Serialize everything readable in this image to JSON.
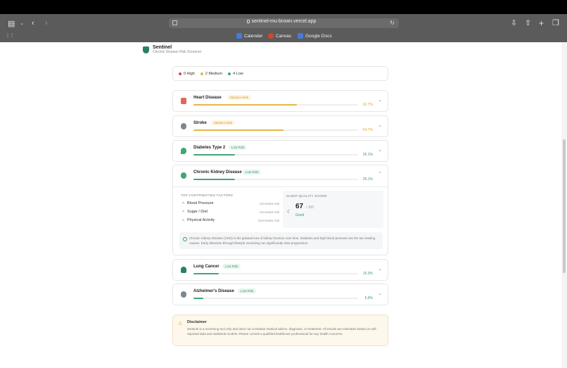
{
  "browser": {
    "url": "sentinel-mu-brown.vercel.app",
    "bookmarks": [
      {
        "label": "Calender",
        "color": "#3f7fe0"
      },
      {
        "label": "Canvas",
        "color": "#d8452b"
      },
      {
        "label": "Google Docs",
        "color": "#4a7bd8"
      }
    ]
  },
  "app": {
    "name": "Sentinel",
    "subtitle": "Chronic Disease Risk Screener"
  },
  "summary": {
    "high": "0 High",
    "medium": "2 Medium",
    "low": "4 Low",
    "colors": {
      "high": "#d94a4a",
      "medium": "#e5b54a",
      "low": "#3fa774"
    }
  },
  "diseases": [
    {
      "name": "Heart Disease",
      "badge": "Medium Risk",
      "level": "med",
      "percent": "62.7%",
      "value": 62.7,
      "icon": "heart-icon",
      "icon_color": "#e0675c"
    },
    {
      "name": "Stroke",
      "badge": "Medium Risk",
      "level": "med",
      "percent": "54.7%",
      "value": 54.7,
      "icon": "brain-icon",
      "icon_color": "#7c8790"
    },
    {
      "name": "Diabetes Type 2",
      "badge": "Low Risk",
      "level": "low",
      "percent": "25.1%",
      "value": 25.1,
      "icon": "drop-icon",
      "icon_color": "#3fa774"
    },
    {
      "name": "Chronic Kidney Disease",
      "badge": "Low Risk",
      "level": "low",
      "percent": "25.1%",
      "value": 25.1,
      "icon": "kidney-icon",
      "icon_color": "#3fa774"
    },
    {
      "name": "Lung Cancer",
      "badge": "Low Risk",
      "level": "low",
      "percent": "15.3%",
      "value": 15.3,
      "icon": "lungs-icon",
      "icon_color": "#2c7f67"
    },
    {
      "name": "Alzheimer's Disease",
      "badge": "Low Risk",
      "level": "low",
      "percent": "5.9%",
      "value": 5.9,
      "icon": "brain-icon",
      "icon_color": "#7c8790"
    }
  ],
  "details": {
    "factors_title": "TOP CONTRIBUTING FACTORS",
    "factors": [
      {
        "name": "Blood Pressure",
        "effect": "Increases risk"
      },
      {
        "name": "Sugar / Diet",
        "effect": "Increases risk"
      },
      {
        "name": "Physical Activity",
        "effect": "Decreases risk"
      }
    ],
    "sleep_title": "SLEEP QUALITY SCORE",
    "sleep_score": "67",
    "sleep_max": "/ 100",
    "sleep_grade": "Good",
    "info": "Chronic Kidney Disease (CKD) is the gradual loss of kidney function over time. Diabetes and high blood pressure are the two leading causes. Early detection through lifestyle screening can significantly slow progression."
  },
  "disclaimer": {
    "title": "Disclaimer",
    "text": "Sentinel is a screening tool only and does not constitute medical advice, diagnosis, or treatment. All results are estimates based on self-reported data and statistical models. Please consult a qualified healthcare professional for any health concerns."
  }
}
